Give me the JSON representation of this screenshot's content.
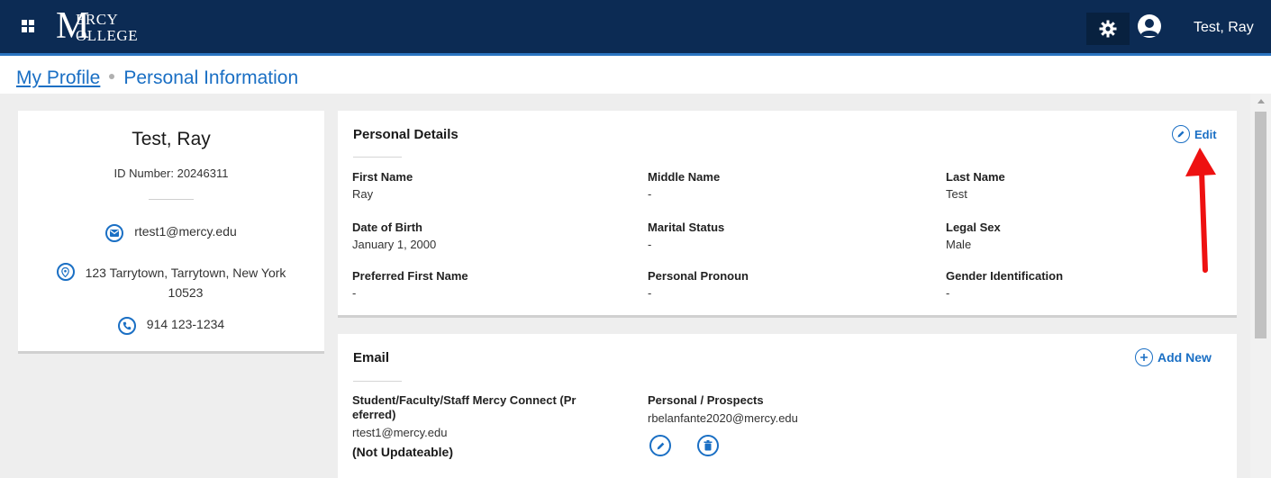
{
  "header": {
    "logo_initial": "M",
    "logo_line1": "ERCY",
    "logo_line2": "OLLEGE",
    "user_name": "Test, Ray",
    "icons": [
      "apps-grid-icon",
      "gear-icon",
      "user-avatar-icon"
    ]
  },
  "breadcrumb": {
    "parent": "My Profile",
    "current": "Personal Information"
  },
  "profile": {
    "name": "Test, Ray",
    "id_number": "ID Number: 20246311",
    "email": "rtest1@mercy.edu",
    "address_line1": "123 Tarrytown, Tarrytown, New York",
    "address_line2": "10523",
    "phone": "914 123-1234"
  },
  "personal_details": {
    "title": "Personal Details",
    "edit_label": "Edit",
    "fields": [
      {
        "label": "First Name",
        "value": "Ray"
      },
      {
        "label": "Middle Name",
        "value": "-"
      },
      {
        "label": "Last Name",
        "value": "Test"
      },
      {
        "label": "Date of Birth",
        "value": "January 1, 2000"
      },
      {
        "label": "Marital Status",
        "value": "-"
      },
      {
        "label": "Legal Sex",
        "value": "Male"
      },
      {
        "label": "Preferred First Name",
        "value": "-"
      },
      {
        "label": "Personal Pronoun",
        "value": "-"
      },
      {
        "label": "Gender Identification",
        "value": "-"
      }
    ]
  },
  "email_section": {
    "title": "Email",
    "add_new_label": "Add New",
    "entries": [
      {
        "label_line1": "Student/Faculty/Staff Mercy Connect (Pr",
        "label_line2": "eferred)",
        "value": "rtest1@mercy.edu",
        "note": "(Not Updateable)"
      },
      {
        "label_line1": "Personal / Prospects",
        "value": "rbelanfante2020@mercy.edu"
      }
    ]
  },
  "colors": {
    "header_bg": "#0c2b54",
    "accent": "#1a6fc4",
    "annotation_arrow": "#ee1111"
  }
}
